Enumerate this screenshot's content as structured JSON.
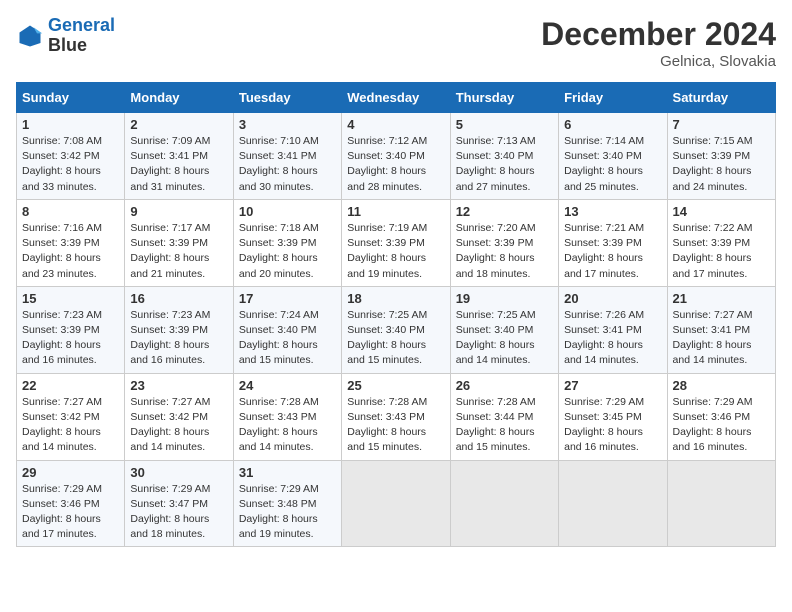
{
  "header": {
    "logo_line1": "General",
    "logo_line2": "Blue",
    "month_title": "December 2024",
    "location": "Gelnica, Slovakia"
  },
  "weekdays": [
    "Sunday",
    "Monday",
    "Tuesday",
    "Wednesday",
    "Thursday",
    "Friday",
    "Saturday"
  ],
  "weeks": [
    [
      {
        "day": "1",
        "sunrise": "Sunrise: 7:08 AM",
        "sunset": "Sunset: 3:42 PM",
        "daylight": "Daylight: 8 hours and 33 minutes."
      },
      {
        "day": "2",
        "sunrise": "Sunrise: 7:09 AM",
        "sunset": "Sunset: 3:41 PM",
        "daylight": "Daylight: 8 hours and 31 minutes."
      },
      {
        "day": "3",
        "sunrise": "Sunrise: 7:10 AM",
        "sunset": "Sunset: 3:41 PM",
        "daylight": "Daylight: 8 hours and 30 minutes."
      },
      {
        "day": "4",
        "sunrise": "Sunrise: 7:12 AM",
        "sunset": "Sunset: 3:40 PM",
        "daylight": "Daylight: 8 hours and 28 minutes."
      },
      {
        "day": "5",
        "sunrise": "Sunrise: 7:13 AM",
        "sunset": "Sunset: 3:40 PM",
        "daylight": "Daylight: 8 hours and 27 minutes."
      },
      {
        "day": "6",
        "sunrise": "Sunrise: 7:14 AM",
        "sunset": "Sunset: 3:40 PM",
        "daylight": "Daylight: 8 hours and 25 minutes."
      },
      {
        "day": "7",
        "sunrise": "Sunrise: 7:15 AM",
        "sunset": "Sunset: 3:39 PM",
        "daylight": "Daylight: 8 hours and 24 minutes."
      }
    ],
    [
      {
        "day": "8",
        "sunrise": "Sunrise: 7:16 AM",
        "sunset": "Sunset: 3:39 PM",
        "daylight": "Daylight: 8 hours and 23 minutes."
      },
      {
        "day": "9",
        "sunrise": "Sunrise: 7:17 AM",
        "sunset": "Sunset: 3:39 PM",
        "daylight": "Daylight: 8 hours and 21 minutes."
      },
      {
        "day": "10",
        "sunrise": "Sunrise: 7:18 AM",
        "sunset": "Sunset: 3:39 PM",
        "daylight": "Daylight: 8 hours and 20 minutes."
      },
      {
        "day": "11",
        "sunrise": "Sunrise: 7:19 AM",
        "sunset": "Sunset: 3:39 PM",
        "daylight": "Daylight: 8 hours and 19 minutes."
      },
      {
        "day": "12",
        "sunrise": "Sunrise: 7:20 AM",
        "sunset": "Sunset: 3:39 PM",
        "daylight": "Daylight: 8 hours and 18 minutes."
      },
      {
        "day": "13",
        "sunrise": "Sunrise: 7:21 AM",
        "sunset": "Sunset: 3:39 PM",
        "daylight": "Daylight: 8 hours and 17 minutes."
      },
      {
        "day": "14",
        "sunrise": "Sunrise: 7:22 AM",
        "sunset": "Sunset: 3:39 PM",
        "daylight": "Daylight: 8 hours and 17 minutes."
      }
    ],
    [
      {
        "day": "15",
        "sunrise": "Sunrise: 7:23 AM",
        "sunset": "Sunset: 3:39 PM",
        "daylight": "Daylight: 8 hours and 16 minutes."
      },
      {
        "day": "16",
        "sunrise": "Sunrise: 7:23 AM",
        "sunset": "Sunset: 3:39 PM",
        "daylight": "Daylight: 8 hours and 16 minutes."
      },
      {
        "day": "17",
        "sunrise": "Sunrise: 7:24 AM",
        "sunset": "Sunset: 3:40 PM",
        "daylight": "Daylight: 8 hours and 15 minutes."
      },
      {
        "day": "18",
        "sunrise": "Sunrise: 7:25 AM",
        "sunset": "Sunset: 3:40 PM",
        "daylight": "Daylight: 8 hours and 15 minutes."
      },
      {
        "day": "19",
        "sunrise": "Sunrise: 7:25 AM",
        "sunset": "Sunset: 3:40 PM",
        "daylight": "Daylight: 8 hours and 14 minutes."
      },
      {
        "day": "20",
        "sunrise": "Sunrise: 7:26 AM",
        "sunset": "Sunset: 3:41 PM",
        "daylight": "Daylight: 8 hours and 14 minutes."
      },
      {
        "day": "21",
        "sunrise": "Sunrise: 7:27 AM",
        "sunset": "Sunset: 3:41 PM",
        "daylight": "Daylight: 8 hours and 14 minutes."
      }
    ],
    [
      {
        "day": "22",
        "sunrise": "Sunrise: 7:27 AM",
        "sunset": "Sunset: 3:42 PM",
        "daylight": "Daylight: 8 hours and 14 minutes."
      },
      {
        "day": "23",
        "sunrise": "Sunrise: 7:27 AM",
        "sunset": "Sunset: 3:42 PM",
        "daylight": "Daylight: 8 hours and 14 minutes."
      },
      {
        "day": "24",
        "sunrise": "Sunrise: 7:28 AM",
        "sunset": "Sunset: 3:43 PM",
        "daylight": "Daylight: 8 hours and 14 minutes."
      },
      {
        "day": "25",
        "sunrise": "Sunrise: 7:28 AM",
        "sunset": "Sunset: 3:43 PM",
        "daylight": "Daylight: 8 hours and 15 minutes."
      },
      {
        "day": "26",
        "sunrise": "Sunrise: 7:28 AM",
        "sunset": "Sunset: 3:44 PM",
        "daylight": "Daylight: 8 hours and 15 minutes."
      },
      {
        "day": "27",
        "sunrise": "Sunrise: 7:29 AM",
        "sunset": "Sunset: 3:45 PM",
        "daylight": "Daylight: 8 hours and 16 minutes."
      },
      {
        "day": "28",
        "sunrise": "Sunrise: 7:29 AM",
        "sunset": "Sunset: 3:46 PM",
        "daylight": "Daylight: 8 hours and 16 minutes."
      }
    ],
    [
      {
        "day": "29",
        "sunrise": "Sunrise: 7:29 AM",
        "sunset": "Sunset: 3:46 PM",
        "daylight": "Daylight: 8 hours and 17 minutes."
      },
      {
        "day": "30",
        "sunrise": "Sunrise: 7:29 AM",
        "sunset": "Sunset: 3:47 PM",
        "daylight": "Daylight: 8 hours and 18 minutes."
      },
      {
        "day": "31",
        "sunrise": "Sunrise: 7:29 AM",
        "sunset": "Sunset: 3:48 PM",
        "daylight": "Daylight: 8 hours and 19 minutes."
      },
      null,
      null,
      null,
      null
    ]
  ]
}
